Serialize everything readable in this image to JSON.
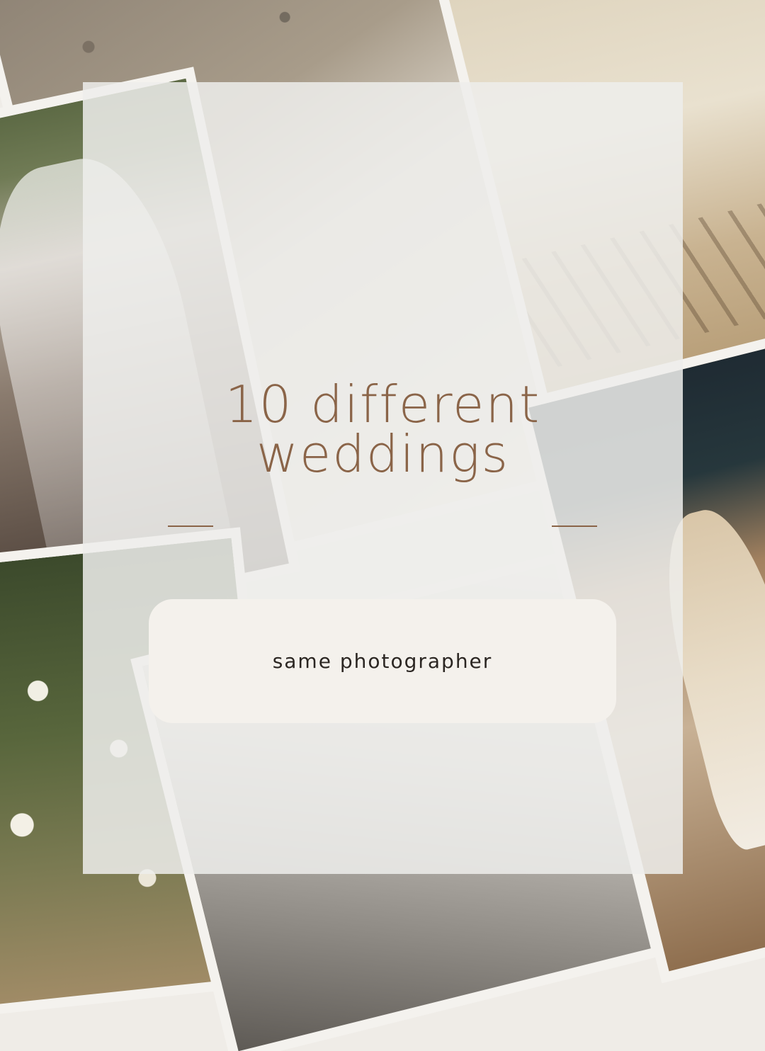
{
  "headline": {
    "line1": "10 different",
    "line2": "weddings"
  },
  "subtitle": "same photographer",
  "colors": {
    "headline": "#8a6448",
    "panel": "#eeedeb",
    "pill": "#f4f1ec",
    "subtitle_text": "#2b2622"
  },
  "photos": [
    "bride-stone-wall",
    "couple-veil-kiss",
    "linen-suit-walk",
    "white-flowers-table",
    "black-white-hands",
    "groom-night-dance"
  ]
}
